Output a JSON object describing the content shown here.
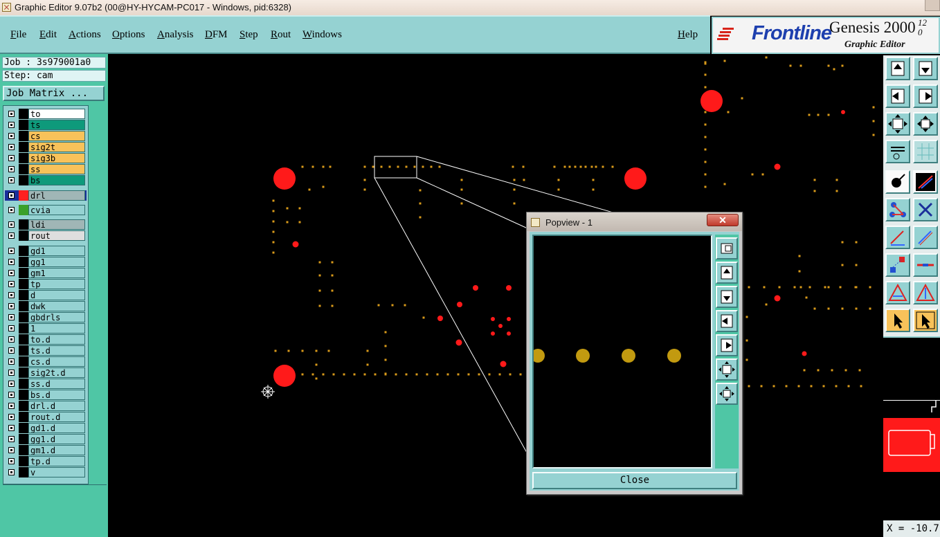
{
  "window": {
    "title": "Graphic Editor 9.07b2 (00@HY-HYCAM-PC017 - Windows, pid:6328)"
  },
  "menu": {
    "items": [
      "File",
      "Edit",
      "Actions",
      "Options",
      "Analysis",
      "DFM",
      "Step",
      "Rout",
      "Windows"
    ],
    "help": "Help"
  },
  "logo": {
    "brand": "Frontline",
    "product": "Genesis 2000",
    "version": "12\n0",
    "subtitle": "Graphic Editor"
  },
  "job": {
    "job_label": "Job : 3s979001a0",
    "step_label": "Step: cam",
    "matrix_button": "Job Matrix ..."
  },
  "layers": [
    {
      "name": "to",
      "color": "#ffffff",
      "block": "#000000"
    },
    {
      "name": "ts",
      "color": "#0e9a7b",
      "block": "#000000"
    },
    {
      "name": "cs",
      "color": "#f8c25a",
      "block": "#000000"
    },
    {
      "name": "sig2t",
      "color": "#f8c25a",
      "block": "#000000"
    },
    {
      "name": "sig3b",
      "color": "#f8c25a",
      "block": "#000000"
    },
    {
      "name": "ss",
      "color": "#f8c25a",
      "block": "#000000"
    },
    {
      "name": "bs",
      "color": "#0e9a7b",
      "block": "#000000"
    },
    {
      "name": "drl",
      "color": "#a0b6b6",
      "block": "#ff2020",
      "active": true
    },
    {
      "name": "cvia",
      "color": "#95d2d2",
      "block": "#3aa02a"
    },
    {
      "name": "ldi",
      "color": "#a0b6b6",
      "block": "#000000"
    },
    {
      "name": "rout",
      "color": "#dedede",
      "block": "#000000"
    },
    {
      "name": "gd1",
      "color": "#95d2d2",
      "block": "#000000"
    },
    {
      "name": "gg1",
      "color": "#95d2d2",
      "block": "#000000"
    },
    {
      "name": "gm1",
      "color": "#95d2d2",
      "block": "#000000"
    },
    {
      "name": "tp",
      "color": "#95d2d2",
      "block": "#000000"
    },
    {
      "name": "d",
      "color": "#95d2d2",
      "block": "#000000"
    },
    {
      "name": "dwk",
      "color": "#95d2d2",
      "block": "#000000"
    },
    {
      "name": "gbdrls",
      "color": "#95d2d2",
      "block": "#000000"
    },
    {
      "name": "1",
      "color": "#95d2d2",
      "block": "#000000"
    },
    {
      "name": "to.d",
      "color": "#95d2d2",
      "block": "#000000"
    },
    {
      "name": "ts.d",
      "color": "#95d2d2",
      "block": "#000000"
    },
    {
      "name": "cs.d",
      "color": "#95d2d2",
      "block": "#000000"
    },
    {
      "name": "sig2t.d",
      "color": "#95d2d2",
      "block": "#000000"
    },
    {
      "name": "ss.d",
      "color": "#95d2d2",
      "block": "#000000"
    },
    {
      "name": "bs.d",
      "color": "#95d2d2",
      "block": "#000000"
    },
    {
      "name": "drl.d",
      "color": "#95d2d2",
      "block": "#000000"
    },
    {
      "name": "rout.d",
      "color": "#95d2d2",
      "block": "#000000"
    },
    {
      "name": "gd1.d",
      "color": "#95d2d2",
      "block": "#000000"
    },
    {
      "name": "gg1.d",
      "color": "#95d2d2",
      "block": "#000000"
    },
    {
      "name": "gm1.d",
      "color": "#95d2d2",
      "block": "#000000"
    },
    {
      "name": "tp.d",
      "color": "#95d2d2",
      "block": "#000000"
    },
    {
      "name": "v",
      "color": "#95d2d2",
      "block": "#000000"
    }
  ],
  "popview": {
    "title": "Popview - 1",
    "close_x": "✕",
    "close_button": "Close"
  },
  "status": {
    "coord": "X = -10.7"
  },
  "colors": {
    "pad": "#d89a1a",
    "drill": "#ff1a1a",
    "panel": "#95d2d2",
    "panel_dark": "#4fc6a5"
  }
}
